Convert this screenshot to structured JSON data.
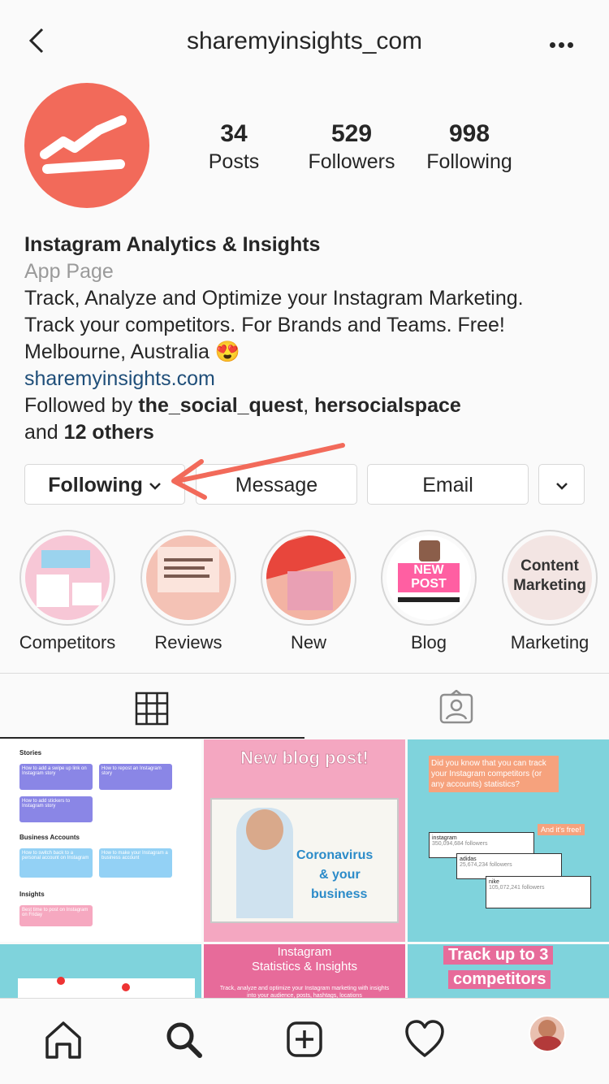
{
  "header": {
    "username": "sharemyinsights_com"
  },
  "stats": [
    {
      "value": "34",
      "label": "Posts"
    },
    {
      "value": "529",
      "label": "Followers"
    },
    {
      "value": "998",
      "label": "Following"
    }
  ],
  "bio": {
    "name": "Instagram Analytics & Insights",
    "category": "App Page",
    "line1": "Track, Analyze and Optimize your Instagram Marketing.",
    "line2": "Track your competitors. For Brands and Teams. Free!",
    "location": "Melbourne, Australia",
    "emoji": "😍",
    "link": "sharemyinsights.com",
    "followed_prefix": "Followed by ",
    "followed_user1": "the_social_quest",
    "followed_sep": ", ",
    "followed_user2": "hersocialspace",
    "followed_and": "and ",
    "followed_others": "12 others"
  },
  "buttons": {
    "following": "Following",
    "message": "Message",
    "email": "Email"
  },
  "highlights": [
    {
      "label": "Competitors"
    },
    {
      "label": "Reviews"
    },
    {
      "label": "New"
    },
    {
      "label": "Blog"
    },
    {
      "label": "Marketing",
      "cover_text1": "Content",
      "cover_text2": "Marketing"
    }
  ],
  "blog_cover": {
    "line1": "NEW",
    "line2": "POST"
  },
  "posts": {
    "p1": {
      "s1": "Stories",
      "s2": "Business Accounts",
      "s3": "Insights",
      "c1": "How to add a swipe up link on Instagram story",
      "c2": "How to repost an Instagram story",
      "c3": "How to add stickers to Instagram story",
      "c4": "How to switch back to a personal account on Instagram",
      "c5": "How to make your Instagram a business account",
      "c6": "Best time to post on Instagram on Friday"
    },
    "p2": {
      "title": "New blog post!",
      "t1": "Coronavirus",
      "t2": "& your",
      "t3": "business"
    },
    "p3": {
      "q": "Did you know that you can track your Instagram competitors (or any accounts) statistics?",
      "free": "And it's free!",
      "a1": "instagram",
      "a1n": "350,094,684 followers",
      "a2": "adidas",
      "a2n": "25,674,234 followers",
      "a3": "nike",
      "a3n": "105,072,241 followers"
    },
    "p5": {
      "l1": "Instagram",
      "l2": "Statistics & Insights",
      "sub": "Track, analyze and optimize your Instagram marketing with insights into your audience, posts, hashtags, locations"
    },
    "p6": {
      "l1": "Track up to 3",
      "l2": "competitors"
    }
  },
  "colors": {
    "brand": "#f26a5a",
    "link": "#1f4e79",
    "arrow": "#f26a5a",
    "teal": "#7fd3dc",
    "pink": "#f4a7c1"
  }
}
